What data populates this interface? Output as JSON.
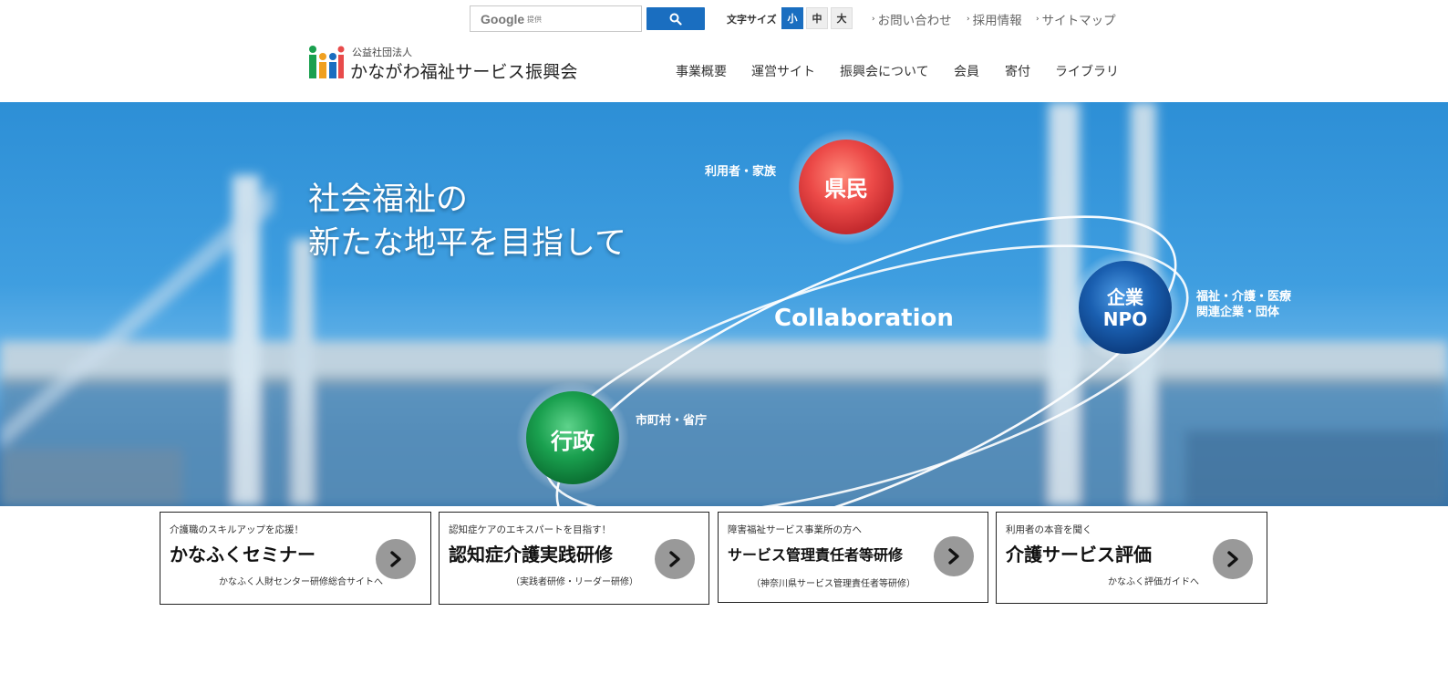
{
  "search": {
    "logo_text": "Google",
    "sub_text": "提供",
    "button_icon": "search-icon"
  },
  "font_size": {
    "label": "文字サイズ",
    "options": [
      "小",
      "中",
      "大"
    ],
    "selected": "小"
  },
  "utility_links": [
    "お問い合わせ",
    "採用情報",
    "サイトマップ"
  ],
  "header": {
    "org_type": "公益社団法人",
    "org_name": "かながわ福祉サービス振興会",
    "logo_icon": "people-logo-icon"
  },
  "nav": [
    "事業概要",
    "運営サイト",
    "振興会について",
    "会員",
    "寄付",
    "ライブラリ"
  ],
  "hero": {
    "title_line1": "社会福祉の",
    "title_line2": "新たな地平を目指して",
    "center_text": "Collaboration",
    "nodes": {
      "kenmin": {
        "label": "県民",
        "caption": "利用者・家族",
        "color": "#e84b4b"
      },
      "kigyo": {
        "label_line1": "企業",
        "label_line2": "NPO",
        "caption_line1": "福祉・介護・医療",
        "caption_line2": "関連企業・団体",
        "color": "#1a5fb0"
      },
      "gyosei": {
        "label": "行政",
        "caption": "市町村・省庁",
        "color": "#1aa04f"
      }
    }
  },
  "cards": [
    {
      "sub": "介護職のスキルアップを応援！",
      "title": "かなふくセミナー",
      "note": "かなふく人財センター研修総合サイトへ"
    },
    {
      "sub": "認知症ケアのエキスパートを目指す！",
      "title": "認知症介護実践研修",
      "note": "（実践者研修・リーダー研修）"
    },
    {
      "sub": "障害福祉サービス事業所の方へ",
      "title": "サービス管理責任者等研修",
      "note": "（神奈川県サービス管理責任者等研修）"
    },
    {
      "sub": "利用者の本音を聞く",
      "title": "介護サービス評価",
      "note": "かなふく評価ガイドへ"
    }
  ],
  "colors": {
    "accent": "#1a6ec0",
    "card_arrow": "#999999"
  }
}
